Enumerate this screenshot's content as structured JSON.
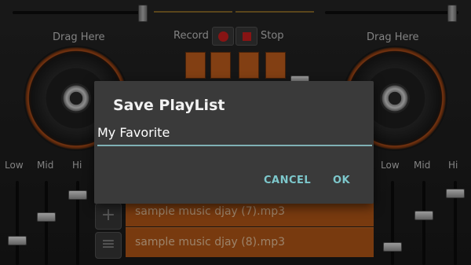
{
  "deck": {
    "left_label": "Drag Here",
    "right_label": "Drag Here"
  },
  "recorder": {
    "record_label": "Record",
    "stop_label": "Stop"
  },
  "eq": {
    "left": [
      "Low",
      "Mid",
      "Hi"
    ],
    "right": [
      "Low",
      "Mid",
      "Hi"
    ]
  },
  "playlist": {
    "items": [
      "sample music djay (7).mp3",
      "sample music djay (8).mp3"
    ],
    "add_icon": "plus-icon",
    "menu_icon": "menu-icon"
  },
  "dialog": {
    "title": "Save PlayList",
    "input_value": "My Favorite",
    "cancel_label": "CANCEL",
    "ok_label": "OK"
  },
  "colors": {
    "accent": "#7dc8cc",
    "deck_ring": "#b5501a",
    "playlist_row": "#b85a18",
    "record_red": "#d02020"
  }
}
